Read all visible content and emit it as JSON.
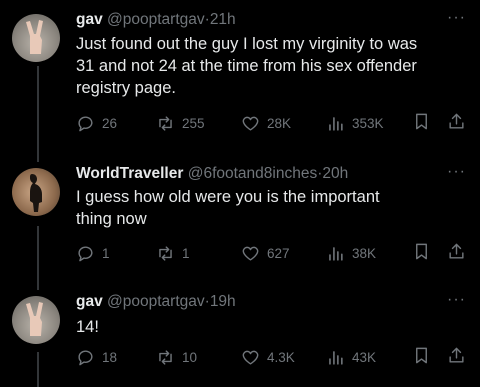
{
  "tweets": [
    {
      "name": "gav",
      "handle": "@pooptartgav",
      "separator": "·",
      "time": "21h",
      "text_lines": [
        "Just found out the guy I lost my virginity to was",
        "31 and not 24 at the time from his sex offender",
        "registry page."
      ],
      "replies": "26",
      "reposts": "255",
      "likes": "28K",
      "views": "353K"
    },
    {
      "name": "WorldTraveller",
      "handle": "@6footand8inches",
      "separator": "·",
      "time": "20h",
      "text_lines": [
        "I guess how old were you is the important",
        "thing now"
      ],
      "replies": "1",
      "reposts": "1",
      "likes": "627",
      "views": "38K"
    },
    {
      "name": "gav",
      "handle": "@pooptartgav",
      "separator": "·",
      "time": "19h",
      "text_lines": [
        "14!"
      ],
      "replies": "18",
      "reposts": "10",
      "likes": "4.3K",
      "views": "43K"
    }
  ],
  "more_glyph": "···",
  "icons": {
    "reply": "reply-icon",
    "repost": "repost-icon",
    "like": "like-icon",
    "views": "views-icon",
    "bookmark": "bookmark-icon",
    "share": "share-icon"
  },
  "colors": {
    "background": "#000000",
    "text": "#e7e9ea",
    "muted": "#71767b",
    "thread_line": "#333639"
  }
}
